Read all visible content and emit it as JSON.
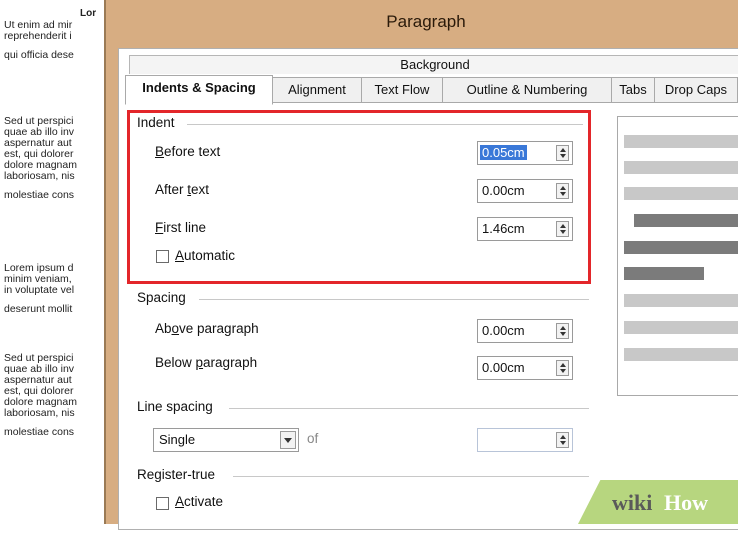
{
  "document": {
    "title": "Lor",
    "lines": [
      "Ut enim ad mir",
      "reprehenderit i",
      "qui officia dese",
      "Sed ut perspici",
      "quae ab illo inv",
      "aspernatur aut",
      "est, qui dolorer",
      "dolore magnam",
      "laboriosam, nis",
      "molestiae cons",
      "Lorem ipsum d",
      "minim veniam,",
      "in voluptate vel",
      "deserunt mollit",
      "Sed ut perspici",
      "quae ab illo inv",
      "aspernatur aut",
      "est, qui dolorer",
      "dolore magnam",
      "laboriosam, nis",
      "molestiae cons"
    ]
  },
  "dialog": {
    "title": "Paragraph",
    "background_tab": "Background",
    "tabs": [
      {
        "label": "Indents & Spacing",
        "active": true
      },
      {
        "label": "Alignment",
        "active": false
      },
      {
        "label": "Text Flow",
        "active": false
      },
      {
        "label": "Outline & Numbering",
        "active": false
      },
      {
        "label": "Tabs",
        "active": false
      },
      {
        "label": "Drop Caps",
        "active": false
      }
    ]
  },
  "indent": {
    "section_label": "Indent",
    "before_text": {
      "label_underlined": "B",
      "label_rest": "efore text",
      "value": "0.05cm"
    },
    "after_text": {
      "label_pre": "After ",
      "label_underlined": "t",
      "label_rest": "ext",
      "value": "0.00cm"
    },
    "first_line": {
      "label_underlined": "F",
      "label_rest": "irst line",
      "value": "1.46cm"
    },
    "automatic": {
      "label_underlined": "A",
      "label_rest": "utomatic",
      "checked": false
    }
  },
  "spacing": {
    "section_label": "Spacing",
    "above": {
      "label_pre": "Ab",
      "label_underlined": "o",
      "label_rest": "ve paragraph",
      "value": "0.00cm"
    },
    "below": {
      "label_pre": "Below ",
      "label_underlined": "p",
      "label_rest": "aragraph",
      "value": "0.00cm"
    }
  },
  "line_spacing": {
    "section_label": "Line spacing",
    "selected": "Single",
    "of_label": "of",
    "of_value": ""
  },
  "register_true": {
    "section_label": "Register-true",
    "activate": {
      "label_underlined": "A",
      "label_rest": "ctivate",
      "checked": false
    }
  },
  "watermark": {
    "wiki": "wiki",
    "how": "How"
  },
  "colors": {
    "dialog_frame": "#d7ad82",
    "highlight": "#e3262a",
    "selection": "#3a78d8",
    "watermark": "#b7d67f"
  }
}
